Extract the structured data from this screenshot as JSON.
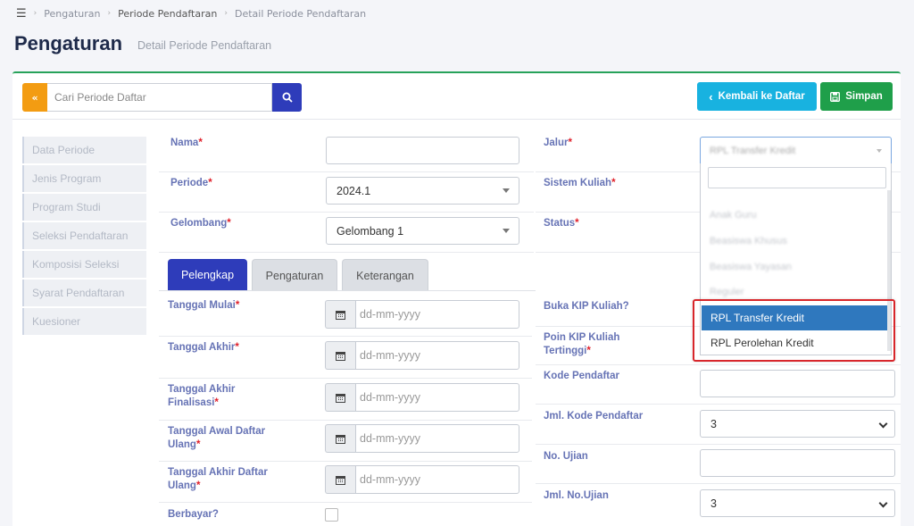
{
  "breadcrumb": [
    "Pengaturan",
    "Periode Pendaftaran",
    "Detail Periode Pendaftaran"
  ],
  "page": {
    "title": "Pengaturan",
    "subtitle": "Detail Periode Pendaftaran"
  },
  "toolbar": {
    "collapse_label": "«",
    "search_placeholder": "Cari Periode Daftar",
    "back_label": "Kembali ke Daftar",
    "save_label": "Simpan"
  },
  "sidebar": [
    "Data Periode",
    "Jenis Program",
    "Program Studi",
    "Seleksi Pendaftaran",
    "Komposisi Seleksi",
    "Syarat Pendaftaran",
    "Kuesioner"
  ],
  "form": {
    "nama": {
      "label": "Nama",
      "value": ""
    },
    "periode": {
      "label": "Periode",
      "value": "2024.1"
    },
    "gelombang": {
      "label": "Gelombang",
      "value": "Gelombang 1"
    },
    "jalur": {
      "label": "Jalur"
    },
    "sistem_kuliah": {
      "label": "Sistem Kuliah"
    },
    "status": {
      "label": "Status"
    }
  },
  "tabs": [
    "Pelengkap",
    "Pengaturan",
    "Keterangan"
  ],
  "pelengkap": {
    "date_placeholder": "dd-mm-yyyy",
    "tanggal_mulai": "Tanggal Mulai",
    "tanggal_akhir": "Tanggal Akhir",
    "tanggal_akhir_finalisasi_1": "Tanggal Akhir",
    "tanggal_akhir_finalisasi_2": "Finalisasi",
    "tanggal_awal_daftar_ulang_1": "Tanggal Awal Daftar",
    "tanggal_awal_daftar_ulang_2": "Ulang",
    "tanggal_akhir_daftar_ulang_1": "Tanggal Akhir Daftar",
    "tanggal_akhir_daftar_ulang_2": "Ulang",
    "berbayar": "Berbayar?",
    "buka_kip": "Buka KIP Kuliah?",
    "poin_kip_1": "Poin KIP Kuliah",
    "poin_kip_2": "Tertinggi",
    "kode_pendaftar": "Kode Pendaftar",
    "jml_kode_pendaftar": {
      "label": "Jml. Kode Pendaftar",
      "value": "3"
    },
    "no_ujian": "No. Ujian",
    "jml_no_ujian": {
      "label": "Jml. No.Ujian",
      "value": "3"
    }
  },
  "required_mark": "*",
  "jalur_dropdown": {
    "selected_blurred": "RPL Transfer Kredit",
    "blurred_options": [
      "Anak Guru",
      "Beasiswa Khusus",
      "Beasiswa Yayasan",
      "Reguler"
    ],
    "highlighted_option": "RPL Transfer Kredit",
    "other_option": "RPL Perolehan Kredit"
  },
  "colors": {
    "primary": "#2e3cba",
    "info": "#18b2e0",
    "success": "#1f9f4a",
    "warning": "#f39c12",
    "highlight_box": "#d8262b"
  }
}
